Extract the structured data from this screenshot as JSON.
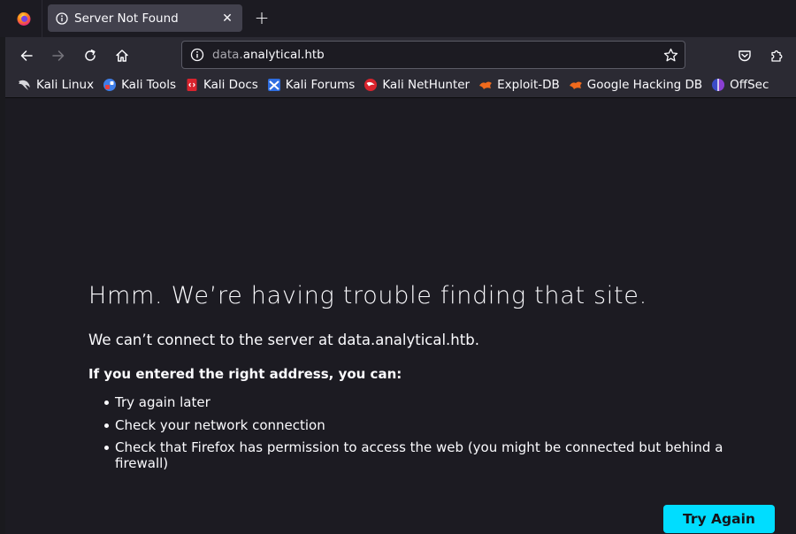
{
  "tab": {
    "title": "Server Not Found",
    "close_glyph": "✕"
  },
  "newtab": {
    "glyph": "+"
  },
  "urlbar": {
    "url_prefix": "data.",
    "url_domain": "analytical.htb"
  },
  "bookmarks": [
    {
      "label": "Kali Linux",
      "icon": "kali-dragon-icon"
    },
    {
      "label": "Kali Tools",
      "icon": "kali-tools-icon"
    },
    {
      "label": "Kali Docs",
      "icon": "kali-docs-icon"
    },
    {
      "label": "Kali Forums",
      "icon": "kali-forums-icon"
    },
    {
      "label": "Kali NetHunter",
      "icon": "kali-nethunter-icon"
    },
    {
      "label": "Exploit-DB",
      "icon": "exploit-db-icon"
    },
    {
      "label": "Google Hacking DB",
      "icon": "google-hacking-db-icon"
    },
    {
      "label": "OffSec",
      "icon": "offsec-icon"
    }
  ],
  "error": {
    "title": "Hmm. We’re having trouble finding that site.",
    "description": "We can’t connect to the server at data.analytical.htb.",
    "subheading": "If you entered the right address, you can:",
    "items": [
      "Try again later",
      "Check your network connection",
      "Check that Firefox has permission to access the web (you might be connected but behind a firewall)"
    ],
    "button_label": "Try Again"
  },
  "colors": {
    "page_bg": "#1c1b22",
    "toolbar_bg": "#2b2a33",
    "tab_active_bg": "#42414d",
    "accent": "#00ddff"
  }
}
